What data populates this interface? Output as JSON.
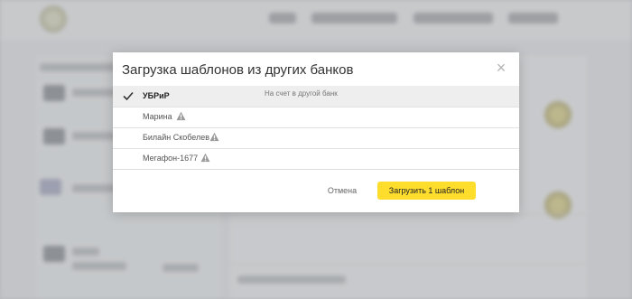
{
  "modal": {
    "title": "Загрузка шаблонов из других банков",
    "close_icon": "×",
    "rows": [
      {
        "name": "УБРиР",
        "selected": true,
        "description": "На счет в другой банк",
        "warning": false
      },
      {
        "name": "Марина",
        "selected": false,
        "description": "",
        "warning": true
      },
      {
        "name": "Билайн Скобелев",
        "selected": false,
        "description": "",
        "warning": true
      },
      {
        "name": "Мегафон-1677",
        "selected": false,
        "description": "",
        "warning": true
      }
    ],
    "cancel_label": "Отмена",
    "submit_label": "Загрузить 1 шаблон"
  },
  "colors": {
    "accent": "#ffdd2d",
    "warning_icon": "#9a9a9a",
    "selected_row": "#eeeeee"
  },
  "icons": {
    "check": "check-icon",
    "warning": "warning-icon",
    "close": "close-icon"
  }
}
